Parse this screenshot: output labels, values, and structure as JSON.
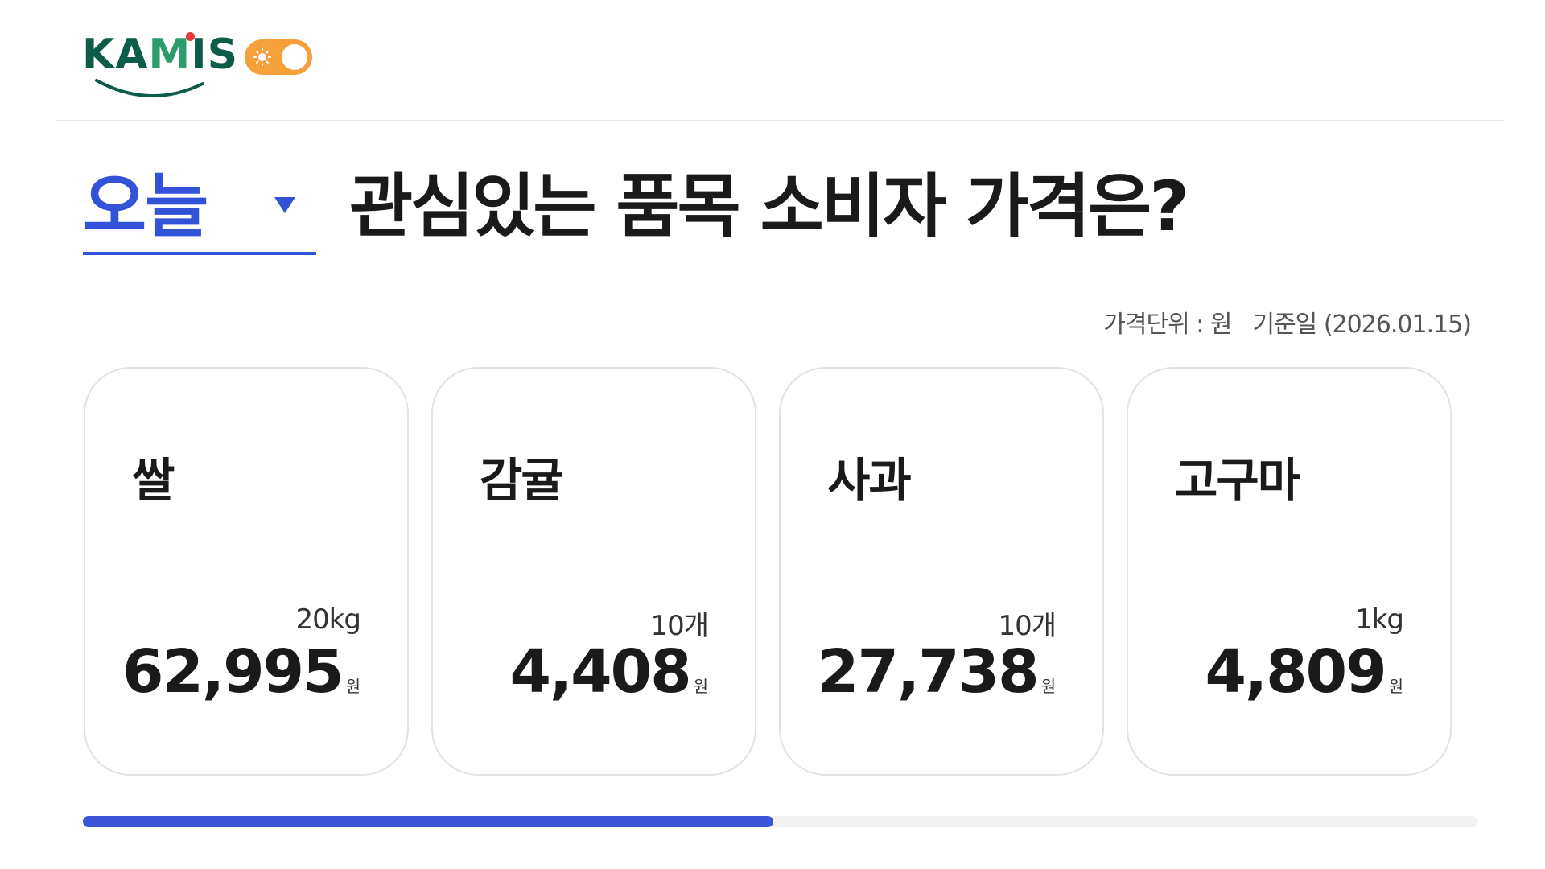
{
  "header": {
    "logo_text": "KAMIS",
    "logo_left": "KA",
    "logo_right": "IS",
    "theme_toggle": {
      "state": "light",
      "icon": "sun-icon",
      "color": "#f5a03a"
    }
  },
  "headline": {
    "period_value": "오늘",
    "question": "관심있는 품목 소비자 가격은?"
  },
  "meta": {
    "unit_label": "가격단위 : 원",
    "base_date_label": "기준일 (2026.01.15)"
  },
  "items": [
    {
      "name": "쌀",
      "unit": "20kg",
      "price": "62,995",
      "currency": "원"
    },
    {
      "name": "감귤",
      "unit": "10개",
      "price": "4,408",
      "currency": "원"
    },
    {
      "name": "사과",
      "unit": "10개",
      "price": "27,738",
      "currency": "원"
    },
    {
      "name": "고구마",
      "unit": "1kg",
      "price": "4,809",
      "currency": "원"
    }
  ],
  "progress": {
    "fraction": 0.495
  },
  "colors": {
    "accent": "#3253d8",
    "toggle": "#f5a03a",
    "logo_green": "#0d5c4a"
  }
}
